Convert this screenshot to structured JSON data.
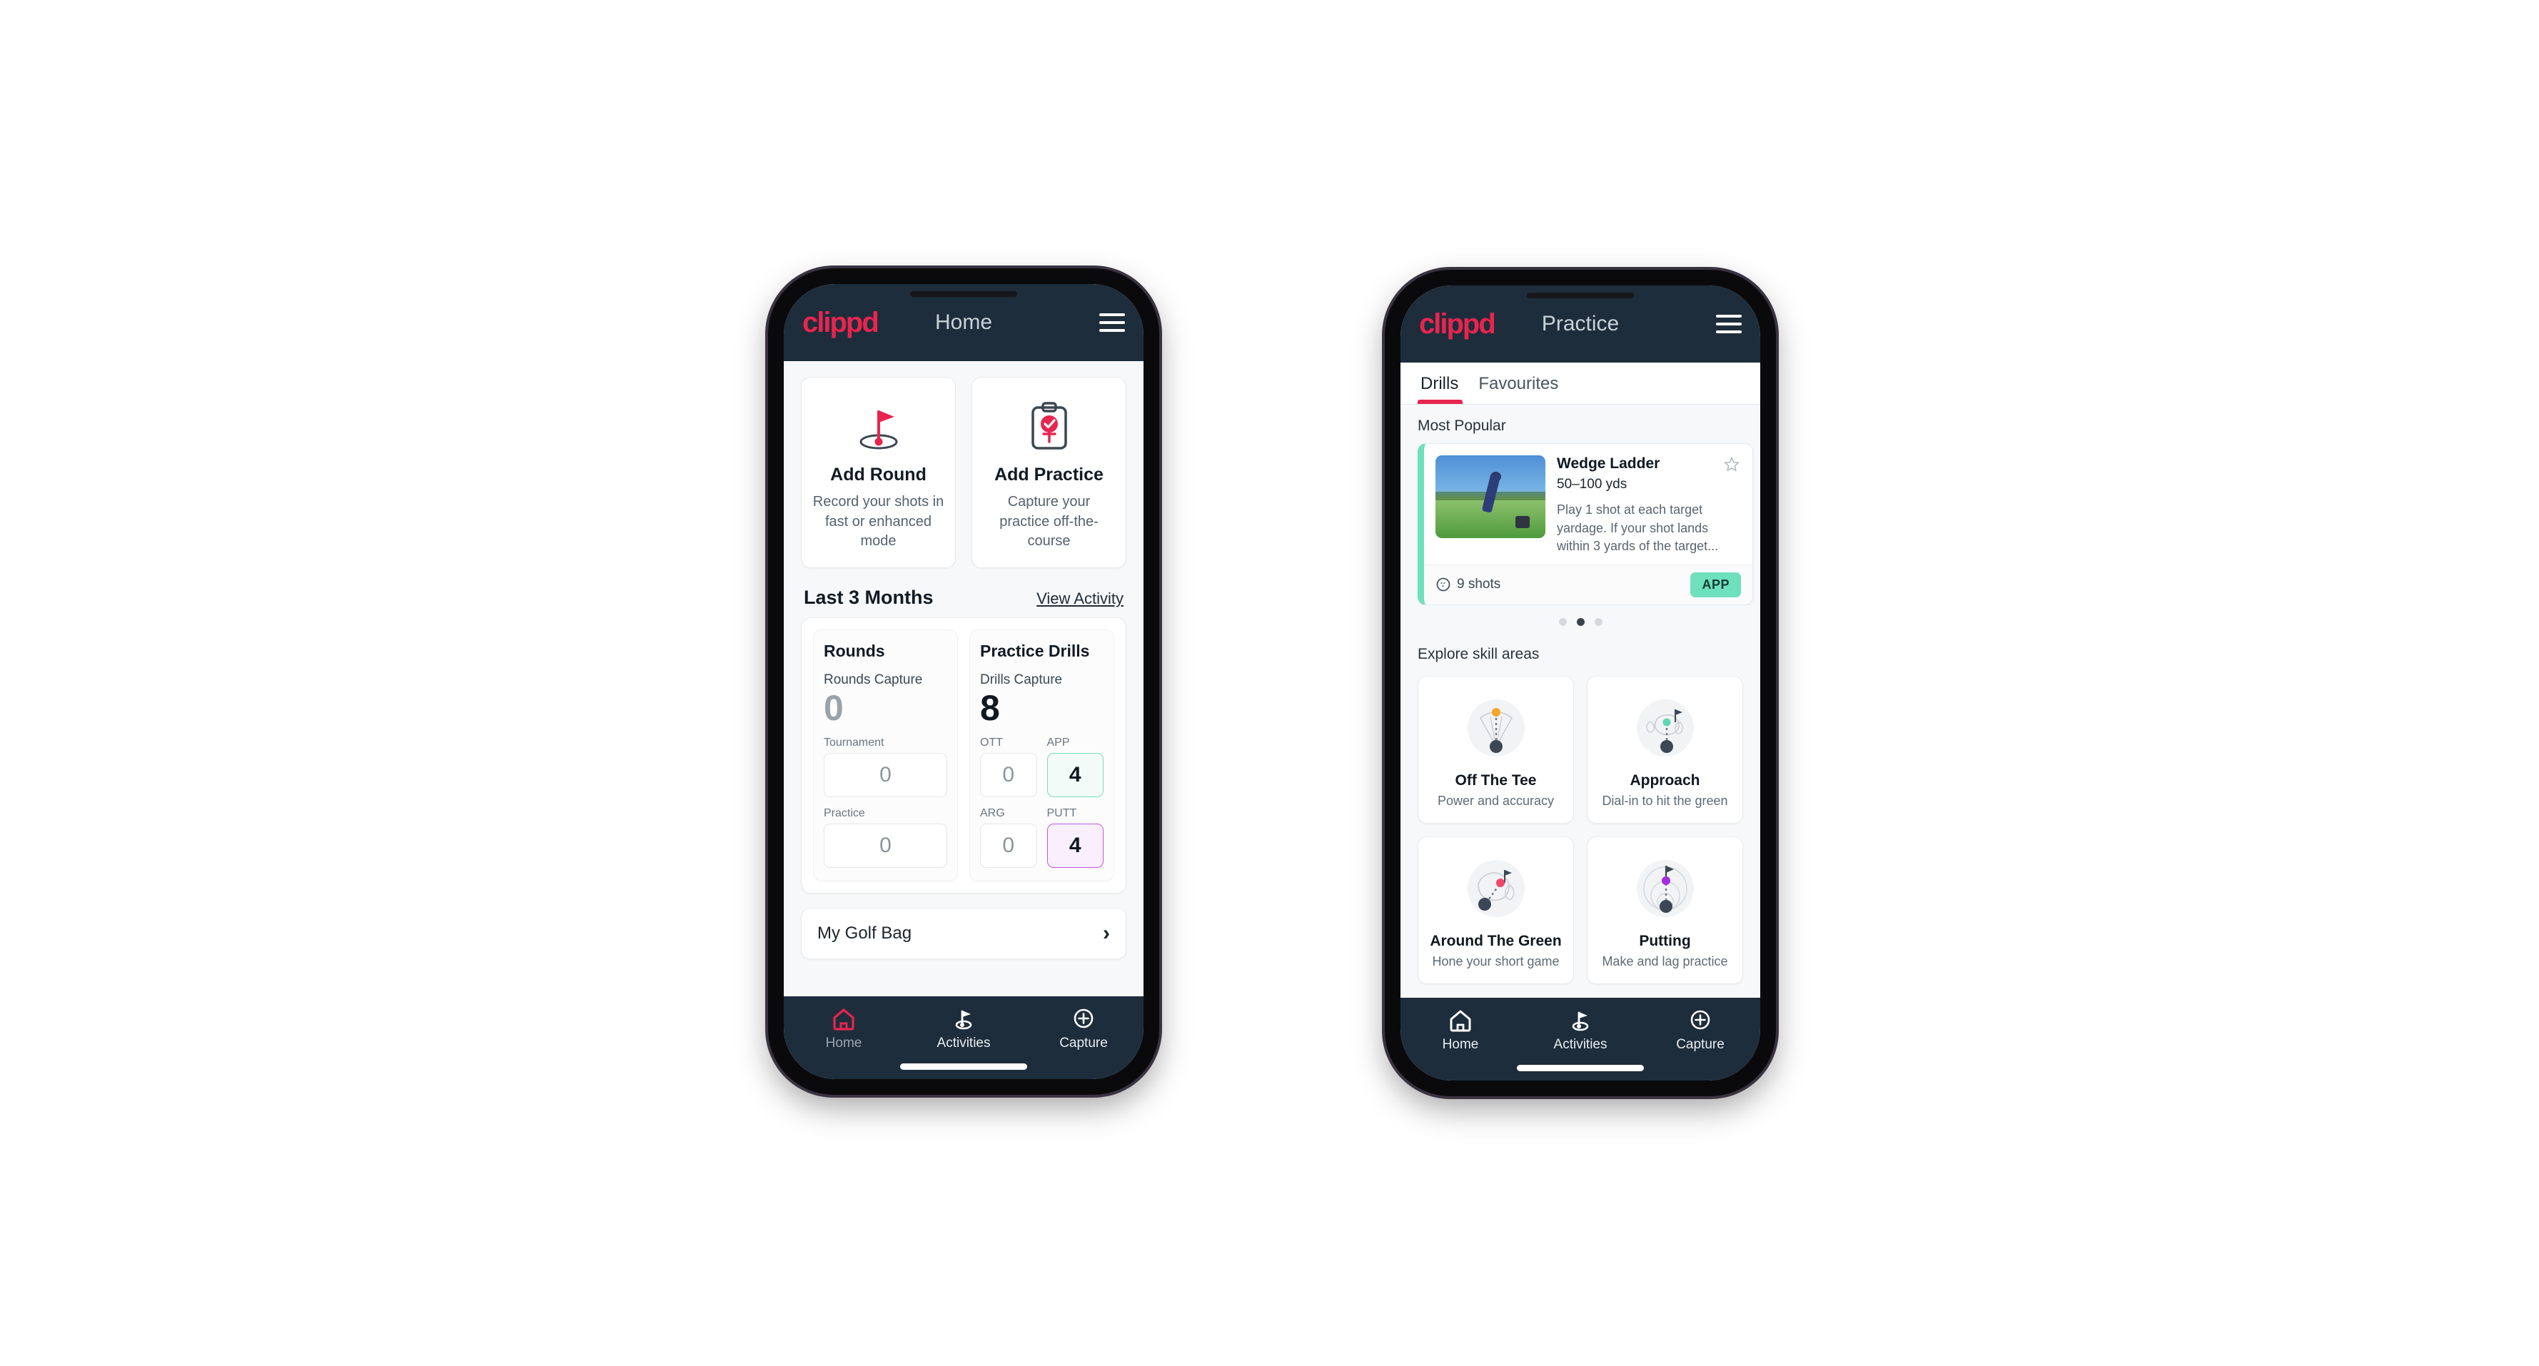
{
  "brand": {
    "name": "clippd",
    "accent": "#e8254f",
    "bar_bg": "#1e2d3b"
  },
  "phone_home": {
    "appbar": {
      "logo": "clippd",
      "title": "Home",
      "menu_icon": "hamburger-menu-icon"
    },
    "actions": [
      {
        "icon": "golf-flag-hole-icon",
        "title": "Add Round",
        "subtitle": "Record your shots in fast or enhanced mode"
      },
      {
        "icon": "clipboard-check-icon",
        "title": "Add Practice",
        "subtitle": "Capture your practice off-the-course"
      }
    ],
    "section": {
      "title": "Last 3 Months",
      "link": "View Activity"
    },
    "stats": {
      "rounds": {
        "heading": "Rounds",
        "capture_label": "Rounds Capture",
        "capture_value": "0",
        "fields": [
          {
            "label": "Tournament",
            "value": "0",
            "style": "plain"
          },
          {
            "label": "Practice",
            "value": "0",
            "style": "plain"
          }
        ]
      },
      "drills": {
        "heading": "Practice Drills",
        "capture_label": "Drills Capture",
        "capture_value": "8",
        "fields": [
          {
            "label": "OTT",
            "value": "0",
            "style": "plain"
          },
          {
            "label": "APP",
            "value": "4",
            "style": "green"
          },
          {
            "label": "ARG",
            "value": "0",
            "style": "plain"
          },
          {
            "label": "PUTT",
            "value": "4",
            "style": "purple"
          }
        ]
      }
    },
    "golf_bag": {
      "label": "My Golf Bag",
      "chevron": "chevron-right-icon"
    },
    "bottom_nav": [
      {
        "icon": "home-icon",
        "label": "Home",
        "active": true
      },
      {
        "icon": "golf-flag-icon",
        "label": "Activities",
        "active": false
      },
      {
        "icon": "plus-circle-icon",
        "label": "Capture",
        "active": false
      }
    ]
  },
  "phone_practice": {
    "appbar": {
      "logo": "clippd",
      "title": "Practice",
      "menu_icon": "hamburger-menu-icon"
    },
    "tabs": [
      {
        "label": "Drills",
        "active": true
      },
      {
        "label": "Favourites",
        "active": false
      }
    ],
    "most_popular_label": "Most Popular",
    "drill_card": {
      "accent": "#6fe0bc",
      "thumbnail": "golfer-wedge-shot-photo",
      "title": "Wedge Ladder",
      "yardage": "50–100 yds",
      "description": "Play 1 shot at each target yardage. If your shot lands within 3 yards of the target...",
      "favourite_icon": "star-outline-icon",
      "shots_icon": "golf-ball-icon",
      "shots": "9 shots",
      "badge": "APP"
    },
    "next_card_accent": "#9c27d8",
    "pager": {
      "count": 3,
      "active_index": 1
    },
    "explore_label": "Explore skill areas",
    "skills": [
      {
        "icon": "off-the-tee-icon",
        "title": "Off The Tee",
        "subtitle": "Power and accuracy",
        "dot": "#f5a623"
      },
      {
        "icon": "approach-icon",
        "title": "Approach",
        "subtitle": "Dial-in to hit the green",
        "dot": "#5fd6b4"
      },
      {
        "icon": "around-the-green-icon",
        "title": "Around The Green",
        "subtitle": "Hone your short game",
        "dot": "#f0486b"
      },
      {
        "icon": "putting-icon",
        "title": "Putting",
        "subtitle": "Make and lag practice",
        "dot": "#a52ce0"
      }
    ],
    "bottom_nav": [
      {
        "icon": "home-icon",
        "label": "Home",
        "active": false
      },
      {
        "icon": "golf-flag-icon",
        "label": "Activities",
        "active": false
      },
      {
        "icon": "plus-circle-icon",
        "label": "Capture",
        "active": false
      }
    ]
  }
}
